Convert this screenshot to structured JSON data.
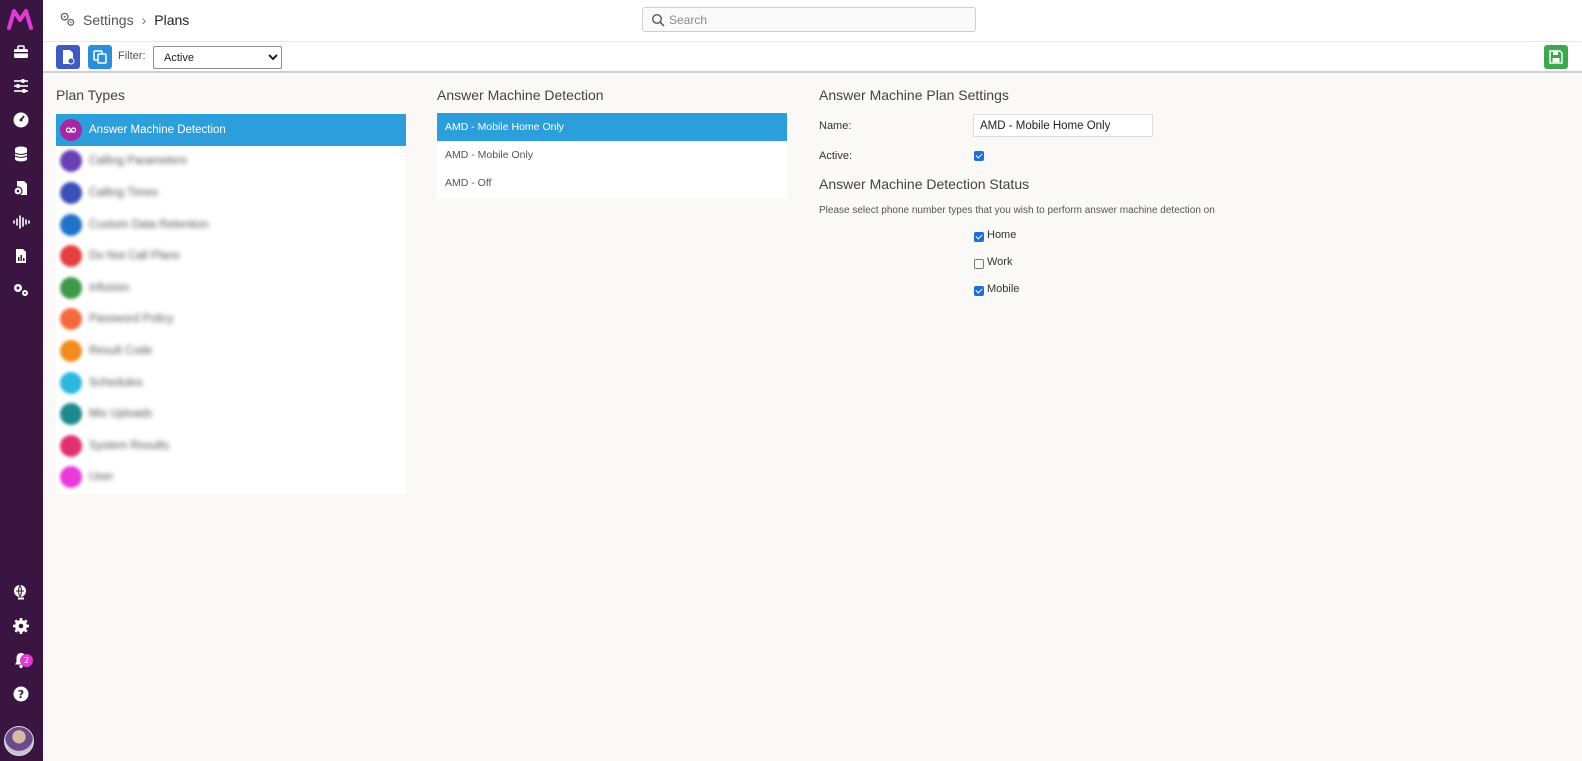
{
  "rail": {
    "logo": "M",
    "notification_count": "2"
  },
  "header": {
    "breadcrumb_root": "Settings",
    "breadcrumb_sep": "›",
    "breadcrumb_current": "Plans",
    "search_placeholder": "Search"
  },
  "toolbar": {
    "filter_label": "Filter:",
    "filter_value": "Active"
  },
  "plan_types": {
    "title": "Plan Types",
    "items": [
      {
        "label": "Answer Machine Detection",
        "color": "#a626a4",
        "selected": true
      },
      {
        "label": "Calling Parameters",
        "color": "#6a3fb3"
      },
      {
        "label": "Calling Times",
        "color": "#3b4fb8"
      },
      {
        "label": "Custom Data Retention",
        "color": "#1f73c9"
      },
      {
        "label": "Do Not Call Plans",
        "color": "#e53e3e"
      },
      {
        "label": "Infusion",
        "color": "#3e9a49"
      },
      {
        "label": "Password Policy",
        "color": "#f26a3c"
      },
      {
        "label": "Result Code",
        "color": "#f08c1e"
      },
      {
        "label": "Schedules",
        "color": "#2cb7e0"
      },
      {
        "label": "Mix Uploads",
        "color": "#1d8a8f"
      },
      {
        "label": "System Results",
        "color": "#e0306e"
      },
      {
        "label": "User",
        "color": "#e83ad8"
      }
    ]
  },
  "plans": {
    "title": "Answer Machine Detection",
    "items": [
      {
        "label": "AMD - Mobile Home Only",
        "selected": true
      },
      {
        "label": "AMD - Mobile Only"
      },
      {
        "label": "AMD - Off"
      }
    ]
  },
  "settings": {
    "title": "Answer Machine Plan Settings",
    "name_label": "Name:",
    "name_value": "AMD - Mobile Home Only",
    "active_label": "Active:",
    "active_checked": true,
    "status_title": "Answer Machine Detection Status",
    "hint": "Please select phone number types that you wish to perform answer machine detection on",
    "types": [
      {
        "label": "Home",
        "checked": true
      },
      {
        "label": "Work",
        "checked": false
      },
      {
        "label": "Mobile",
        "checked": true
      }
    ]
  },
  "colors": {
    "rail_bg": "#3b1541",
    "brand": "#e23ad5",
    "selection": "#2c9edb",
    "save": "#3da851"
  }
}
